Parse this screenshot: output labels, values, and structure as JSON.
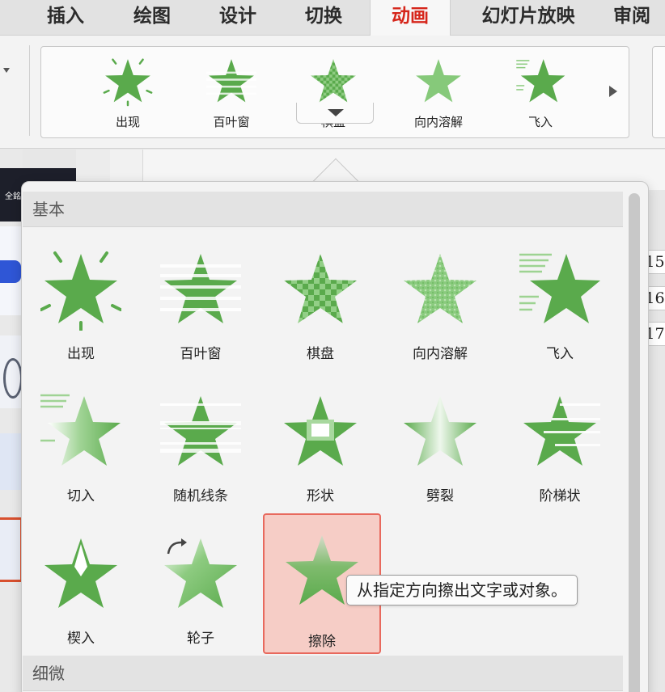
{
  "tabs": [
    {
      "label": "插入",
      "active": false
    },
    {
      "label": "绘图",
      "active": false
    },
    {
      "label": "设计",
      "active": false
    },
    {
      "label": "切换",
      "active": false
    },
    {
      "label": "动画",
      "active": true
    },
    {
      "label": "幻灯片放映",
      "active": false
    },
    {
      "label": "审阅",
      "active": false
    }
  ],
  "ribbon_gallery": [
    {
      "label": "出现",
      "icon": "appear-star-icon"
    },
    {
      "label": "百叶窗",
      "icon": "blinds-star-icon"
    },
    {
      "label": "棋盘",
      "icon": "checkerboard-star-icon"
    },
    {
      "label": "向内溶解",
      "icon": "dissolve-in-star-icon"
    },
    {
      "label": "飞入",
      "icon": "fly-in-star-icon"
    }
  ],
  "thumbnail": {
    "text": "全銘"
  },
  "row_numbers": [
    "15",
    "16",
    "17"
  ],
  "popup": {
    "section_basic": "基本",
    "section_subtle": "细微",
    "items": [
      {
        "label": "出现",
        "icon": "appear-star-icon"
      },
      {
        "label": "百叶窗",
        "icon": "blinds-star-icon"
      },
      {
        "label": "棋盘",
        "icon": "checkerboard-star-icon"
      },
      {
        "label": "向内溶解",
        "icon": "dissolve-in-star-icon"
      },
      {
        "label": "飞入",
        "icon": "fly-in-star-icon"
      },
      {
        "label": "切入",
        "icon": "peek-in-star-icon"
      },
      {
        "label": "随机线条",
        "icon": "random-bars-star-icon"
      },
      {
        "label": "形状",
        "icon": "shape-star-icon"
      },
      {
        "label": "劈裂",
        "icon": "split-star-icon"
      },
      {
        "label": "阶梯状",
        "icon": "stairs-star-icon"
      },
      {
        "label": "楔入",
        "icon": "wedge-star-icon"
      },
      {
        "label": "轮子",
        "icon": "wheel-star-icon"
      },
      {
        "label": "擦除",
        "icon": "wipe-star-icon",
        "selected": true
      }
    ],
    "tooltip": "从指定方向擦出文字或对象。"
  },
  "colors": {
    "star_green": "#5aaa4c",
    "active_tab": "#d6261b",
    "selected_fill": "#f6cdc6",
    "selected_border": "#e8695d"
  }
}
